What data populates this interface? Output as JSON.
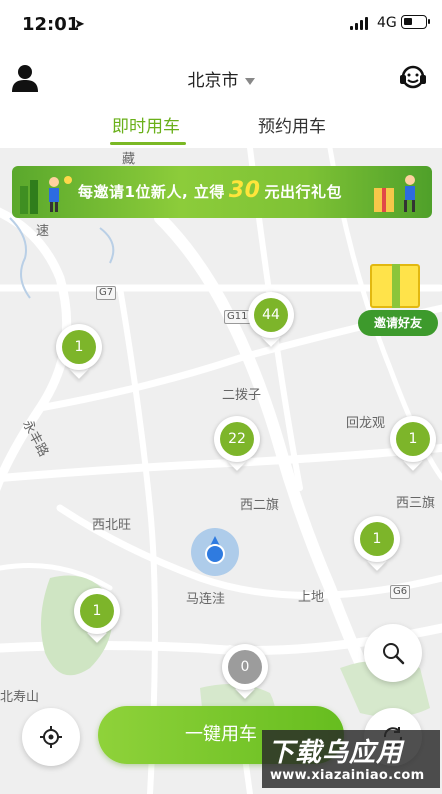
{
  "status_bar": {
    "time": "12:01",
    "network": "4G"
  },
  "header": {
    "city": "北京市",
    "tabs": [
      {
        "label": "即时用车",
        "active": true
      },
      {
        "label": "预约用车",
        "active": false
      }
    ]
  },
  "banner": {
    "text_before": "每邀请1位新人, 立得",
    "amount": "30",
    "text_after": "元出行礼包"
  },
  "invite": {
    "label": "邀请好友"
  },
  "map": {
    "labels": [
      "藏",
      "速",
      "二拨子",
      "回龙观",
      "永丰路",
      "西二旗",
      "西三旗",
      "西北旺",
      "马连洼",
      "上地",
      "北寿山"
    ],
    "road_badges": [
      "G7",
      "G110",
      "G6"
    ]
  },
  "pins": [
    {
      "count": "1",
      "status": "available"
    },
    {
      "count": "44",
      "status": "available"
    },
    {
      "count": "22",
      "status": "available"
    },
    {
      "count": "1",
      "status": "available"
    },
    {
      "count": "1",
      "status": "available"
    },
    {
      "count": "1",
      "status": "available"
    },
    {
      "count": "0",
      "status": "empty"
    }
  ],
  "actions": {
    "primary_label": "一键用车"
  },
  "watermark": {
    "title": "下载乌应用",
    "url": "www.xiazainiao.com"
  },
  "colors": {
    "accent": "#7ab824",
    "pin_active": "#7db52a",
    "pin_empty": "#9c9c9c",
    "location": "#2f7be0"
  },
  "icons": [
    "location-arrow-icon",
    "signal-icon",
    "battery-icon",
    "user-icon",
    "caret-down-icon",
    "customer-service-icon",
    "search-icon",
    "locate-icon",
    "refresh-icon"
  ]
}
